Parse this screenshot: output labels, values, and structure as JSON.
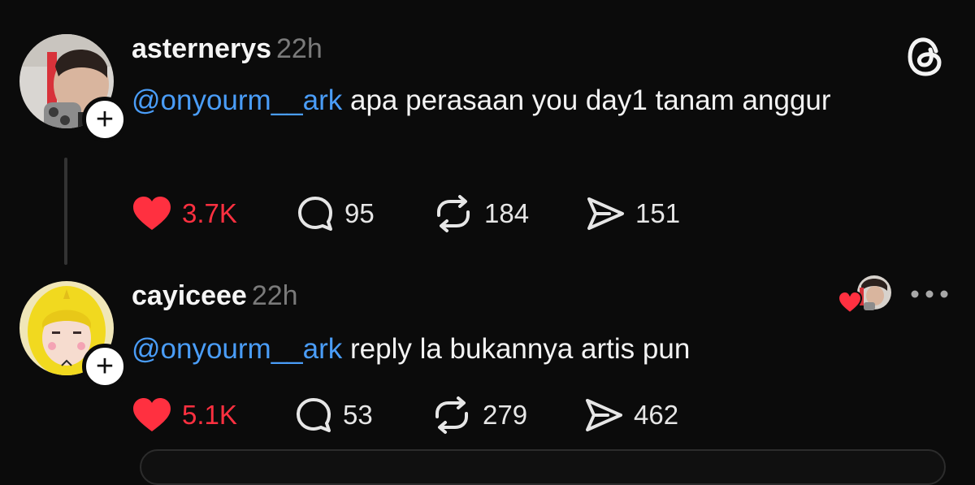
{
  "posts": [
    {
      "username": "asternerys",
      "time": "22h",
      "mention": "@onyourm__ark",
      "text": " apa perasaan you day1 tanam anggur",
      "likes": "3.7K",
      "replies": "95",
      "reposts": "184",
      "shares": "151"
    },
    {
      "username": "cayiceee",
      "time": "22h",
      "mention": "@onyourm__ark",
      "text": " reply la bukannya artis pun",
      "likes": "5.1K",
      "replies": "53",
      "reposts": "279",
      "shares": "462"
    }
  ],
  "badge_symbol": "+",
  "colors": {
    "background": "#0b0b0b",
    "mention": "#4a9df8",
    "like": "#ff3040",
    "muted": "#7a7a7a"
  },
  "icons": [
    "threads-logo-icon",
    "heart-icon",
    "reply-bubble-icon",
    "repost-icon",
    "share-icon",
    "plus-icon",
    "more-dots-icon"
  ]
}
